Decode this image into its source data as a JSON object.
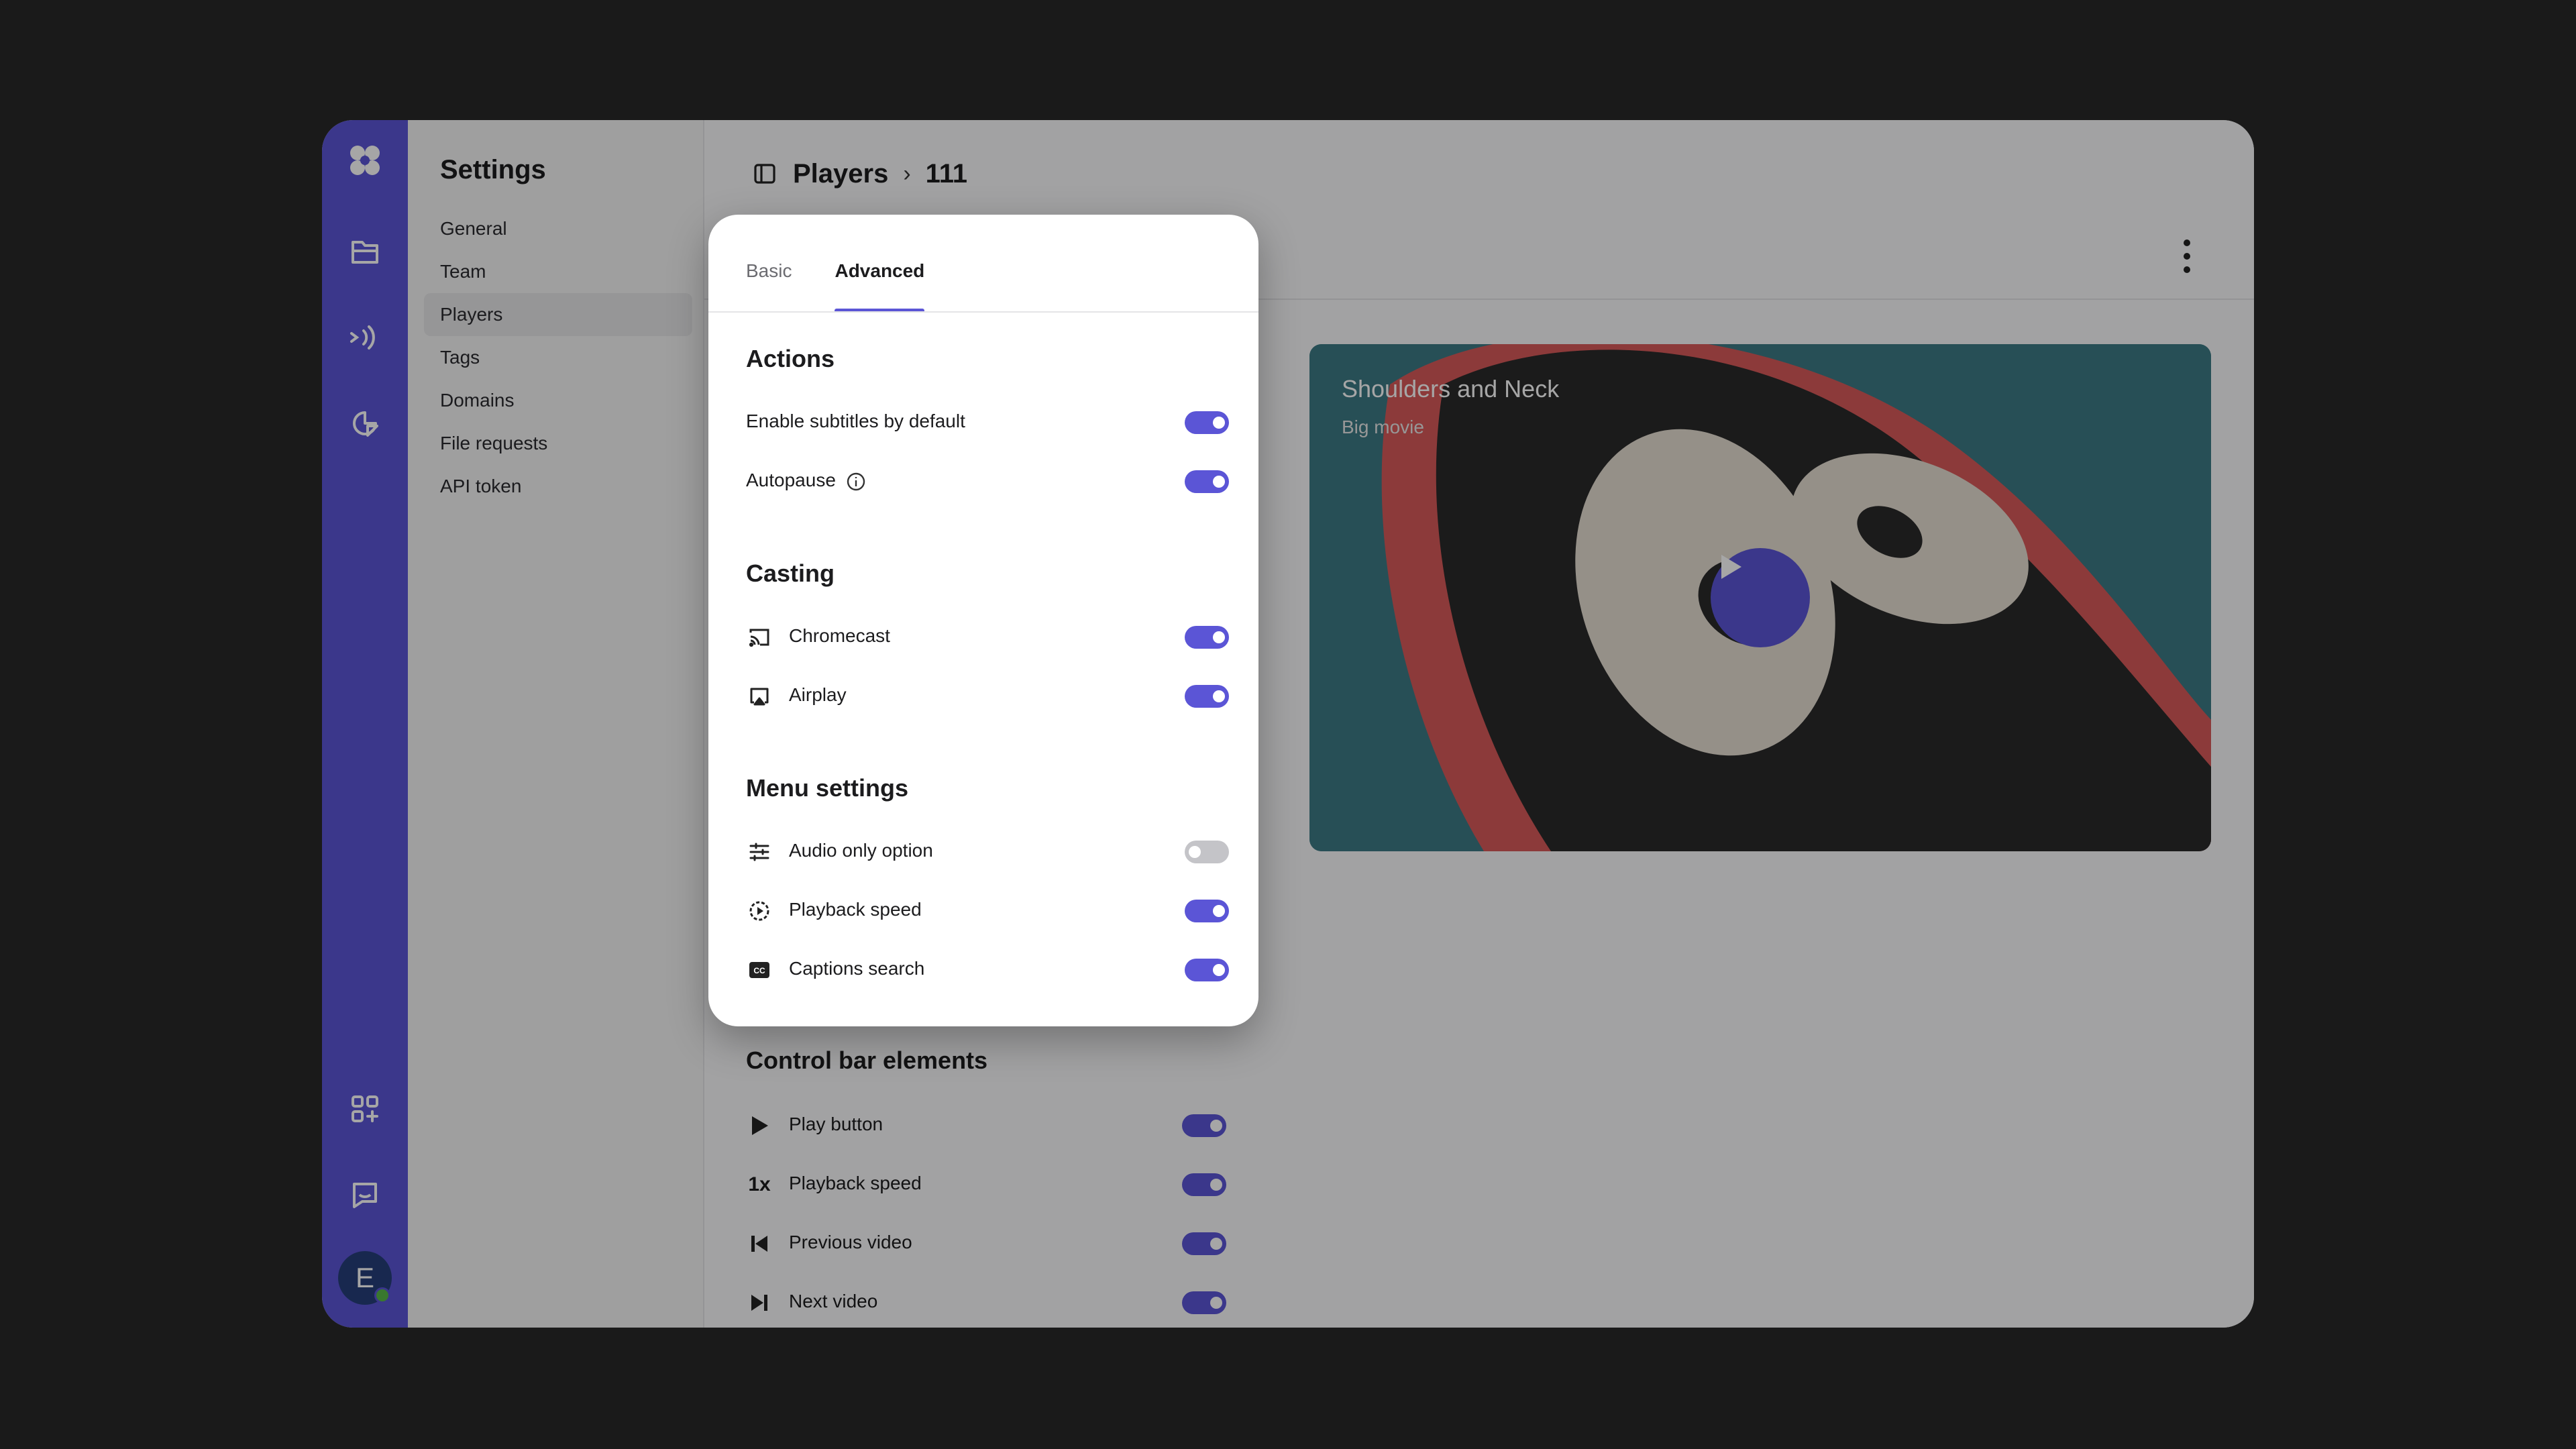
{
  "nav": {
    "title": "Settings",
    "items": [
      {
        "label": "General"
      },
      {
        "label": "Team"
      },
      {
        "label": "Players",
        "active": true
      },
      {
        "label": "Tags"
      },
      {
        "label": "Domains"
      },
      {
        "label": "File requests"
      },
      {
        "label": "API token"
      }
    ]
  },
  "rail": {
    "icons": [
      "logo-icon",
      "folder-icon",
      "broadcast-icon",
      "analytics-icon",
      "apps-add-icon",
      "feedback-icon"
    ],
    "avatar_initial": "E",
    "accent": "#5b55d6"
  },
  "breadcrumb": {
    "parent": "Players",
    "current": "111"
  },
  "video": {
    "title": "Shoulders and Neck",
    "subtitle": "Big movie"
  },
  "dialog": {
    "tabs": [
      {
        "label": "Basic",
        "active": false
      },
      {
        "label": "Advanced",
        "active": true
      }
    ],
    "sections": [
      {
        "title": "Actions",
        "rows": [
          {
            "label": "Enable subtitles by default",
            "icon": "",
            "on": true
          },
          {
            "label": "Autopause",
            "icon": "info-icon",
            "on": true
          }
        ]
      },
      {
        "title": "Casting",
        "rows": [
          {
            "label": "Chromecast",
            "icon": "chromecast-icon",
            "on": true
          },
          {
            "label": "Airplay",
            "icon": "airplay-icon",
            "on": true
          }
        ]
      },
      {
        "title": "Menu settings",
        "rows": [
          {
            "label": "Audio only option",
            "icon": "sliders-icon",
            "on": false
          },
          {
            "label": "Playback speed",
            "icon": "speed-dial-icon",
            "on": true
          },
          {
            "label": "Captions search",
            "icon": "cc-icon",
            "on": true
          }
        ]
      }
    ]
  },
  "control_bar": {
    "title": "Control bar elements",
    "rows": [
      {
        "label": "Play button",
        "icon": "play-icon",
        "on": true
      },
      {
        "label": "Playback speed",
        "icon": "speed-1x-icon",
        "icon_text": "1x",
        "on": true
      },
      {
        "label": "Previous video",
        "icon": "previous-icon",
        "on": true
      },
      {
        "label": "Next video",
        "icon": "next-icon",
        "on": true
      }
    ]
  }
}
